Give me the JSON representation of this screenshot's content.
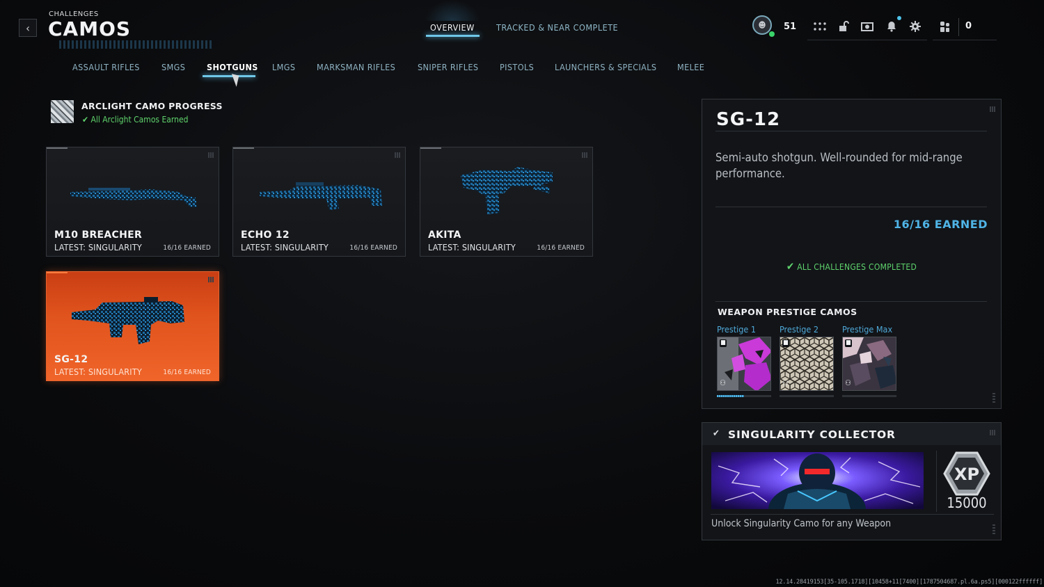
{
  "header": {
    "breadcrumb": "CHALLENGES",
    "title": "CAMOS",
    "tabs": [
      {
        "label": "OVERVIEW",
        "active": true
      },
      {
        "label": "TRACKED & NEAR COMPLETE",
        "active": false
      }
    ],
    "player_level": "51",
    "currency": "0",
    "icons": [
      "grid-icon",
      "unlock-icon",
      "camera-icon",
      "bell-icon",
      "gear-icon",
      "social-icon"
    ]
  },
  "categories": [
    {
      "label": "ASSAULT RIFLES",
      "active": false
    },
    {
      "label": "SMGS",
      "active": false
    },
    {
      "label": "SHOTGUNS",
      "active": true
    },
    {
      "label": "LMGS",
      "active": false
    },
    {
      "label": "MARKSMAN RIFLES",
      "active": false
    },
    {
      "label": "SNIPER RIFLES",
      "active": false
    },
    {
      "label": "PISTOLS",
      "active": false
    },
    {
      "label": "LAUNCHERS & SPECIALS",
      "active": false
    },
    {
      "label": "MELEE",
      "active": false
    }
  ],
  "arclight": {
    "title": "ARCLIGHT CAMO PROGRESS",
    "status": "All Arclight Camos Earned"
  },
  "weapons": [
    {
      "name": "M10 BREACHER",
      "latest": "LATEST: SINGULARITY",
      "earned": "16/16 EARNED",
      "selected": false
    },
    {
      "name": "ECHO 12",
      "latest": "LATEST: SINGULARITY",
      "earned": "16/16 EARNED",
      "selected": false
    },
    {
      "name": "AKITA",
      "latest": "LATEST: SINGULARITY",
      "earned": "16/16 EARNED",
      "selected": false
    },
    {
      "name": "SG-12",
      "latest": "LATEST: SINGULARITY",
      "earned": "16/16 EARNED",
      "selected": true
    }
  ],
  "detail": {
    "name": "SG-12",
    "description": "Semi-auto shotgun. Well-rounded for mid-range performance.",
    "earned": "16/16 EARNED",
    "challenges_status": "ALL CHALLENGES COMPLETED",
    "prestige_section": "WEAPON PRESTIGE CAMOS",
    "prestige": [
      {
        "label": "Prestige 1",
        "progress": 0.5
      },
      {
        "label": "Prestige 2",
        "progress": 0
      },
      {
        "label": "Prestige Max",
        "progress": 0
      }
    ]
  },
  "collector": {
    "title": "SINGULARITY COLLECTOR",
    "reward_label": "XP",
    "reward_amount": "15000",
    "description": "Unlock Singularity Camo for any Weapon"
  },
  "build_string": "12.14.28419153[35-105.1718][10458+11[7400][1787504687.pl.6a.ps5][000122ffffff]",
  "colors": {
    "accent_blue": "#4fb4e6",
    "success_green": "#5fd36c",
    "selected_orange": "#e0531d",
    "background": "#07080a"
  }
}
